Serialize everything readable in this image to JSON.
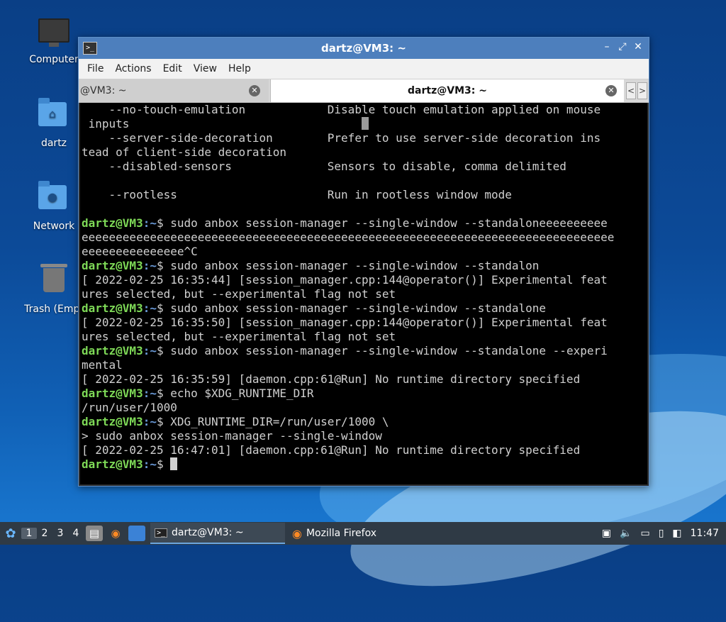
{
  "desktop": {
    "icons": [
      {
        "label": "Computer",
        "icon": "computer-icon"
      },
      {
        "label": "dartz",
        "icon": "home-folder-icon"
      },
      {
        "label": "Network",
        "icon": "network-folder-icon"
      },
      {
        "label": "Trash (Empt",
        "icon": "trash-icon"
      }
    ]
  },
  "window": {
    "title": "dartz@VM3: ~",
    "menu": [
      "File",
      "Actions",
      "Edit",
      "View",
      "Help"
    ],
    "tabs": [
      {
        "label": "@VM3: ~",
        "active": false
      },
      {
        "label": "dartz@VM3: ~",
        "active": true
      }
    ],
    "scroll_left": "<",
    "scroll_right": ">"
  },
  "terminal": {
    "lines": [
      {
        "type": "out",
        "text": "    --no-touch-emulation            Disable touch emulation applied on mouse"
      },
      {
        "type": "out",
        "text": " inputs"
      },
      {
        "type": "out",
        "text": "    --server-side-decoration        Prefer to use server-side decoration ins"
      },
      {
        "type": "out",
        "text": "tead of client-side decoration"
      },
      {
        "type": "out",
        "text": "    --disabled-sensors              Sensors to disable, comma delimited"
      },
      {
        "type": "out",
        "text": ""
      },
      {
        "type": "out",
        "text": "    --rootless                      Run in rootless window mode"
      },
      {
        "type": "out",
        "text": ""
      },
      {
        "type": "cmd",
        "user": "dartz@VM3",
        "path": ":~",
        "text": "$ sudo anbox session-manager --single-window --standaloneeeeeeeeee"
      },
      {
        "type": "out",
        "text": "eeeeeeeeeeeeeeeeeeeeeeeeeeeeeeeeeeeeeeeeeeeeeeeeeeeeeeeeeeeeeeeeeeeeeeeeeeeeee"
      },
      {
        "type": "out",
        "text": "eeeeeeeeeeeeeee^C"
      },
      {
        "type": "cmd",
        "user": "dartz@VM3",
        "path": ":~",
        "text": "$ sudo anbox session-manager --single-window --standalon"
      },
      {
        "type": "out",
        "text": "[ 2022-02-25 16:35:44] [session_manager.cpp:144@operator()] Experimental feat"
      },
      {
        "type": "out",
        "text": "ures selected, but --experimental flag not set"
      },
      {
        "type": "cmd",
        "user": "dartz@VM3",
        "path": ":~",
        "text": "$ sudo anbox session-manager --single-window --standalone"
      },
      {
        "type": "out",
        "text": "[ 2022-02-25 16:35:50] [session_manager.cpp:144@operator()] Experimental feat"
      },
      {
        "type": "out",
        "text": "ures selected, but --experimental flag not set"
      },
      {
        "type": "cmd",
        "user": "dartz@VM3",
        "path": ":~",
        "text": "$ sudo anbox session-manager --single-window --standalone --experi"
      },
      {
        "type": "out",
        "text": "mental"
      },
      {
        "type": "out",
        "text": "[ 2022-02-25 16:35:59] [daemon.cpp:61@Run] No runtime directory specified"
      },
      {
        "type": "cmd",
        "user": "dartz@VM3",
        "path": ":~",
        "text": "$ echo $XDG_RUNTIME_DIR"
      },
      {
        "type": "out",
        "text": "/run/user/1000"
      },
      {
        "type": "cmd",
        "user": "dartz@VM3",
        "path": ":~",
        "text": "$ XDG_RUNTIME_DIR=/run/user/1000 \\"
      },
      {
        "type": "out",
        "text": "> sudo anbox session-manager --single-window"
      },
      {
        "type": "out",
        "text": "[ 2022-02-25 16:47:01] [daemon.cpp:61@Run] No runtime directory specified"
      },
      {
        "type": "cmd",
        "user": "dartz@VM3",
        "path": ":~",
        "text": "$ ",
        "cursor": true
      }
    ]
  },
  "taskbar": {
    "workspaces": [
      "1",
      "2",
      "3",
      "4"
    ],
    "active_workspace": "1",
    "tasks": [
      {
        "label": "dartz@VM3: ~",
        "icon": "terminal-icon",
        "active": true
      },
      {
        "label": "Mozilla Firefox",
        "icon": "firefox-icon",
        "active": false
      }
    ],
    "clock": "11:47"
  }
}
